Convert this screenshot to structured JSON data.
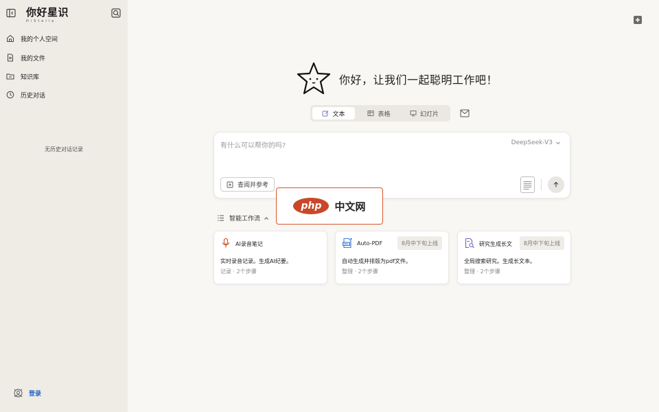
{
  "sidebar": {
    "brand_title": "你好星识",
    "brand_subtitle": "HiStella",
    "items": [
      {
        "label": "我的个人空间",
        "icon": "home-icon"
      },
      {
        "label": "我的文件",
        "icon": "file-icon"
      },
      {
        "label": "知识库",
        "icon": "folder-icon"
      },
      {
        "label": "历史对话",
        "icon": "history-icon"
      }
    ],
    "empty_history": "无历史对话记录",
    "login_label": "登录"
  },
  "main": {
    "greeting": "你好，让我们一起聪明工作吧！",
    "tabs": [
      {
        "label": "文本",
        "icon": "text-edit-icon",
        "active": true
      },
      {
        "label": "表格",
        "icon": "table-icon",
        "active": false
      },
      {
        "label": "幻灯片",
        "icon": "slides-icon",
        "active": false
      }
    ],
    "composer": {
      "placeholder": "有什么可以帮你的吗?",
      "model": "DeepSeek-V3",
      "reference_button": "查阅并参考"
    },
    "workflow": {
      "heading": "智能工作流",
      "cards": [
        {
          "title": "AI录音笔记",
          "badge": "",
          "description": "实时录音记录。生成AI纪要。",
          "meta": "记录 · 2个步骤",
          "icon": "microphone-icon"
        },
        {
          "title": "Auto-PDF",
          "badge": "8月中下旬上线",
          "description": "自动生成并排版为pdf文件。",
          "meta": "整理 · 2个步骤",
          "icon": "pdf-icon"
        },
        {
          "title": "研究生成长文",
          "badge": "8月中下旬上线",
          "description": "全局搜索研究。生成长文本。",
          "meta": "整理 · 2个步骤",
          "icon": "research-doc-icon"
        }
      ]
    }
  },
  "watermark": {
    "logo": "php",
    "text": "中文网"
  },
  "colors": {
    "accent": "#2563c9",
    "sidebar_bg": "#efece6",
    "page_bg": "#f8f7f4",
    "mic": "#d9542b",
    "pdf": "#3b7bd4",
    "research": "#7b5bc7"
  }
}
